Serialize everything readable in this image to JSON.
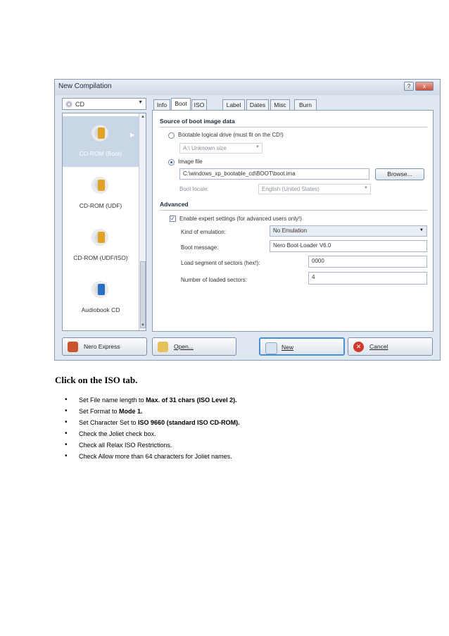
{
  "window": {
    "title": "New Compilation",
    "controls": [
      "?",
      "x"
    ]
  },
  "media_select": {
    "value": "CD"
  },
  "media_list": [
    {
      "label": "CD-ROM (Boot)",
      "selected": true,
      "icon": "cd-rom-boot-icon"
    },
    {
      "label": "CD-ROM (UDF)",
      "selected": false,
      "icon": "cd-rom-udf-icon"
    },
    {
      "label": "CD-ROM (UDF/ISO)",
      "selected": false,
      "icon": "cd-rom-udf-iso-icon"
    },
    {
      "label": "Audiobook CD",
      "selected": false,
      "icon": "audiobook-cd-icon"
    }
  ],
  "tabs": [
    "Info",
    "Boot",
    "ISO",
    "Label",
    "Dates",
    "Misc",
    "Burn"
  ],
  "active_tab": "Boot",
  "boot": {
    "source_header": "Source of boot image data",
    "radio_drive_label": "Bootable logical drive (must fit on the CD!)",
    "drive_value": "A:\\ Unknown size",
    "radio_image_label": "Image file",
    "image_path": "C:\\windows_xp_bootable_cd\\BOOT\\boot.ima",
    "browse_label": "Browse...",
    "locale_label": "Boot locale:",
    "locale_value": "English (United States)",
    "advanced_header": "Advanced",
    "expert_label": "Enable expert settings (for advanced users only!)",
    "emulation_label": "Kind of emulation:",
    "emulation_value": "No Emulation",
    "message_label": "Boot message:",
    "message_value": "Nero Boot-Loader V6.0",
    "segment_label": "Load segment of sectors (hex!):",
    "segment_value": "0000",
    "sectors_label": "Number of loaded sectors:",
    "sectors_value": "4"
  },
  "buttons": {
    "nero_express": "Nero Express",
    "open": "Open...",
    "new": "New",
    "cancel": "Cancel"
  },
  "doc": {
    "caption": "Click on the ISO tab.",
    "bullets": [
      {
        "pre": "Set File name length to ",
        "bold": "Max. of 31 chars (ISO Level 2).",
        "post": ""
      },
      {
        "pre": "Set Format to ",
        "bold": "Mode 1.",
        "post": ""
      },
      {
        "pre": "Set Character Set to ",
        "bold": "ISO 9660 (standard ISO CD-ROM).",
        "post": ""
      },
      {
        "pre": "Check the Joliet check box.",
        "bold": "",
        "post": ""
      },
      {
        "pre": "Check all Relax ISO Restrictions.",
        "bold": "",
        "post": ""
      },
      {
        "pre": "Check Allow more than 64 characters for Joliet names.",
        "bold": "",
        "post": ""
      }
    ]
  }
}
